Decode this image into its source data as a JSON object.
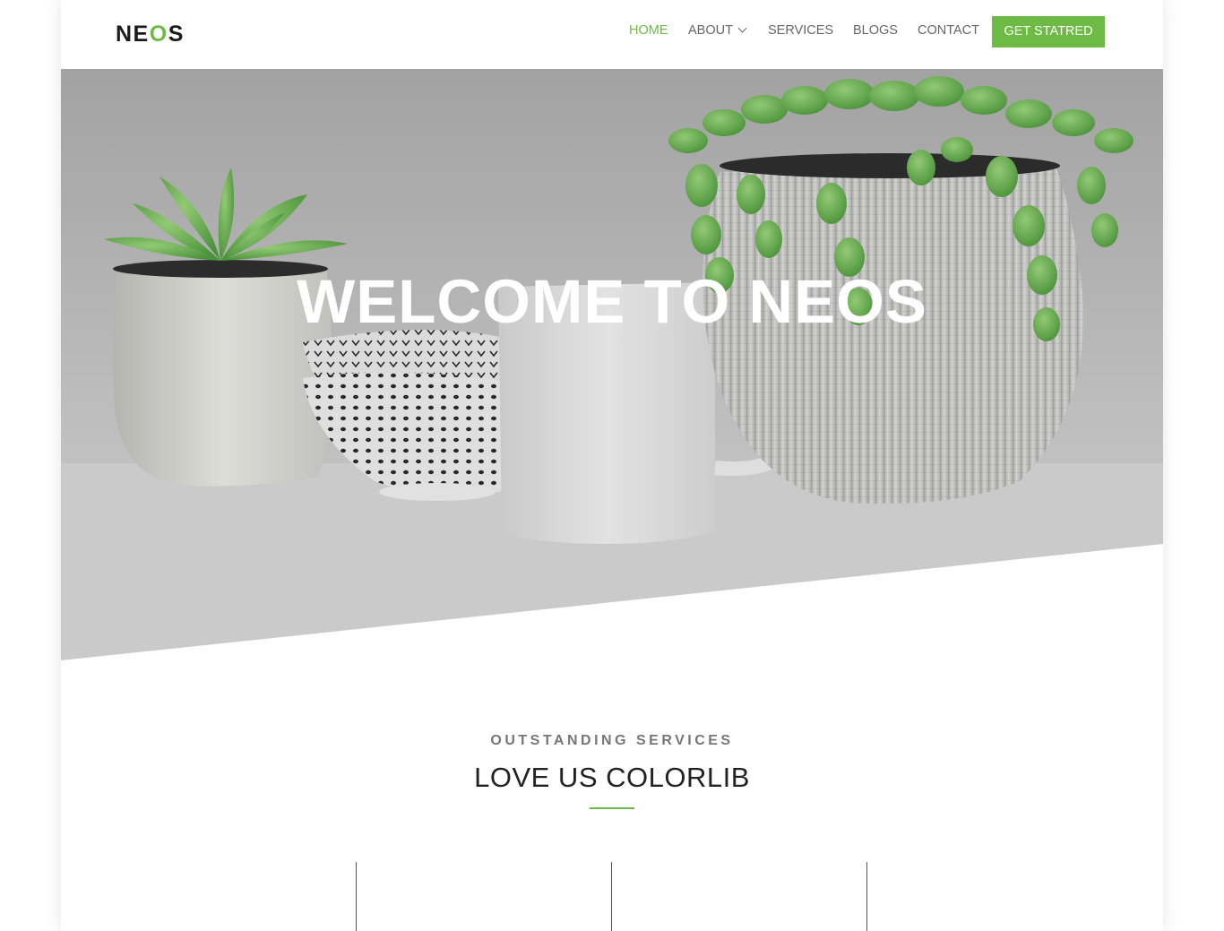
{
  "brand": {
    "logo_part1": "NE",
    "logo_accent": "O",
    "logo_part2": "S",
    "accent_color": "#6dbb44"
  },
  "nav": {
    "home": "HOME",
    "about": "ABOUT",
    "services": "SERVICES",
    "blogs": "BLOGS",
    "contact": "CONTACT",
    "cta": "GET STATRED"
  },
  "hero": {
    "title": "WELCOME TO NEOS"
  },
  "services": {
    "eyebrow": "OUTSTANDING SERVICES",
    "title": "LOVE US COLORLIB"
  }
}
